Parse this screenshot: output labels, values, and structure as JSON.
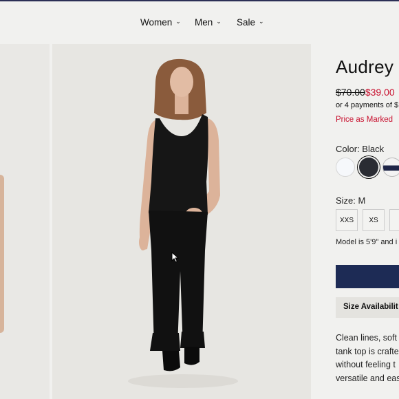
{
  "nav": {
    "items": [
      {
        "label": "Women"
      },
      {
        "label": "Men"
      },
      {
        "label": "Sale"
      }
    ]
  },
  "product": {
    "title": "Audrey",
    "original_price": "$70.00",
    "sale_price": "$39.00",
    "payments_text": "or 4 payments of $",
    "price_note": "Price as Marked",
    "color_label": "Color: Black",
    "colors": [
      "white-swatch",
      "black-swatch",
      "navy-stripe-swatch"
    ],
    "size_label": "Size: M",
    "sizes": [
      "XXS",
      "XS",
      ""
    ],
    "model_note": "Model is 5'9\" and i",
    "availability_button": "Size Availabilit",
    "description_lines": [
      "Clean lines, soft",
      "tank top is crafte",
      "without feeling t",
      "versatile and eas"
    ]
  },
  "colors": {
    "accent_navy": "#1d2b55",
    "sale_red": "#c8102e",
    "background": "#f1f1ef"
  }
}
